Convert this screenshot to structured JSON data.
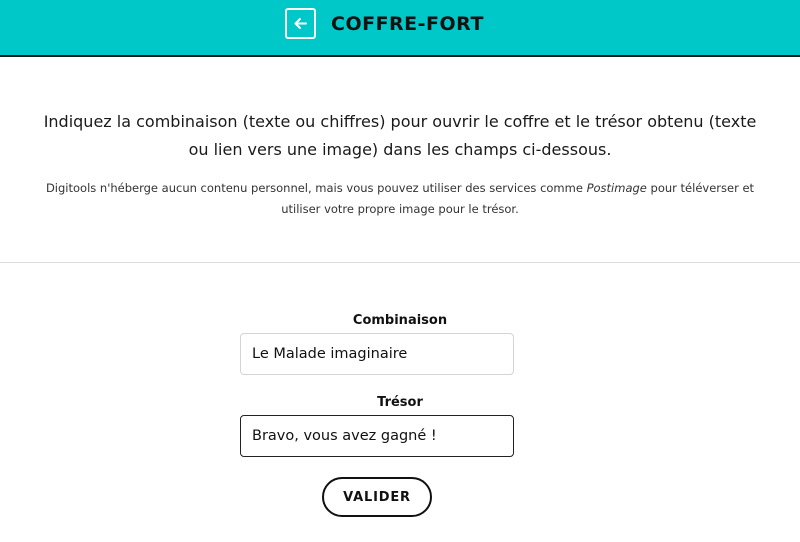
{
  "header": {
    "title": "COFFRE-FORT",
    "back_icon": "arrow-left-icon",
    "background_color": "#00c8c8"
  },
  "intro": {
    "main_text": "Indiquez la combinaison (texte ou chiffres) pour ouvrir le coffre et le trésor obtenu (texte ou lien vers une image) dans les champs ci-dessous.",
    "note_before": "Digitools n'héberge aucun contenu personnel, mais vous pouvez utiliser des services comme ",
    "note_service": "Postimage",
    "note_after": " pour téléverser et utiliser votre propre image pour le trésor."
  },
  "form": {
    "combinaison_label": "Combinaison",
    "combinaison_value": "Le Malade imaginaire",
    "tresor_label": "Trésor",
    "tresor_value": "Bravo, vous avez gagné !",
    "submit_label": "VALIDER"
  }
}
